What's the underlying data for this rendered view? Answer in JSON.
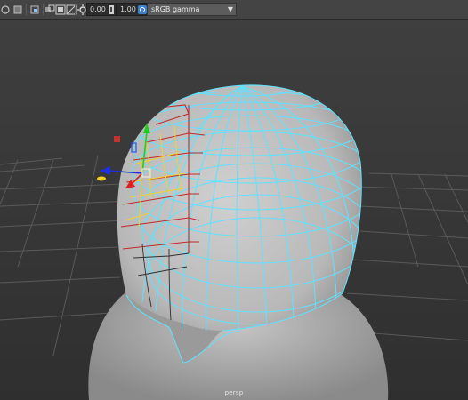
{
  "toolbar": {
    "exposure_value": "0.00",
    "gamma_value": "1.00",
    "color_space": "sRGB gamma",
    "icons": [
      "display-icon",
      "shade-icon",
      "frame-icon",
      "isolate-icon",
      "xray-icon",
      "grid-icon",
      "exposure-icon",
      "gamma-icon",
      "colorspace-icon"
    ]
  },
  "viewport": {
    "camera_label": "persp",
    "colors": {
      "background": "#3a3a3a",
      "wireframe": "#5fe2ff",
      "selected_edges": "#c22a2a",
      "soft_select": "#f0d030",
      "manip_x": "#e02020",
      "manip_y": "#20d020",
      "manip_z": "#2030e0"
    }
  }
}
